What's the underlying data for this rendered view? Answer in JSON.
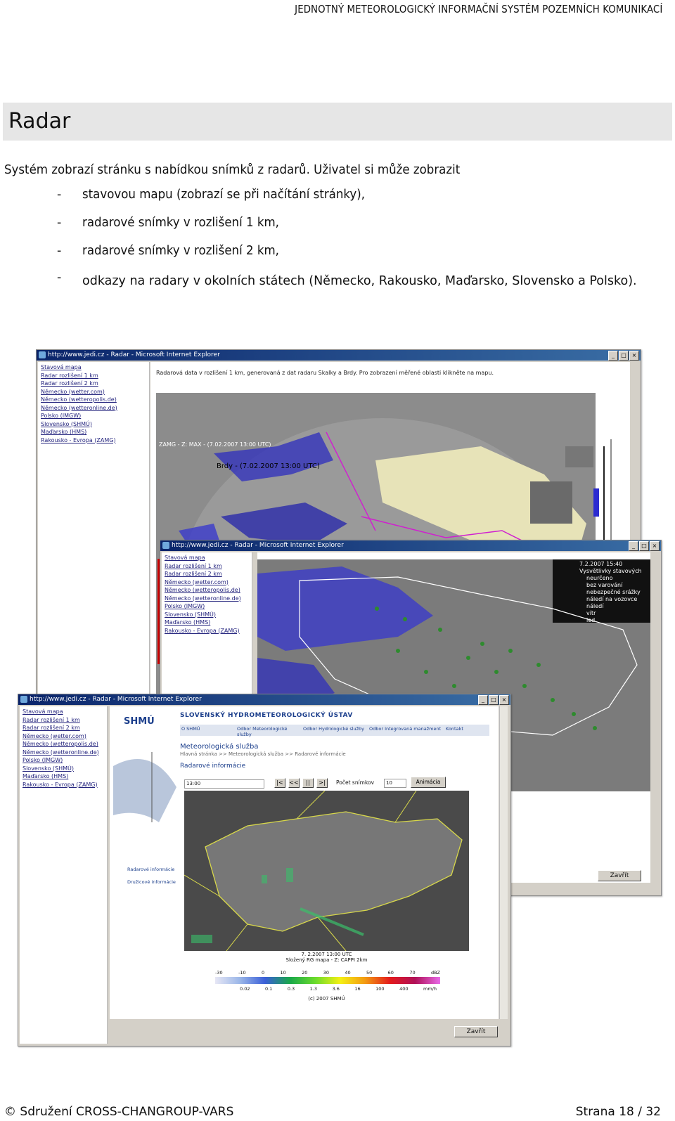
{
  "header": {
    "title": "JEDNOTNÝ METEOROLOGICKÝ INFORMAČNÍ SYSTÉM POZEMNÍCH KOMUNIKACÍ"
  },
  "section": {
    "title": "Radar"
  },
  "intro": "Systém zobrazí stránku s nabídkou snímků z radarů. Uživatel si může zobrazit",
  "bullets": [
    "stavovou mapu (zobrazí se při načítání stránky),",
    "radarové snímky v rozlišení 1 km,",
    "radarové snímky v rozlišení 2 km,",
    "odkazy na radary v okolních státech (Německo, Rakousko, Maďarsko, Slovensko a Polsko)."
  ],
  "bullet_dash": "-",
  "footer": {
    "left": "© Sdružení CROSS-CHANGROUP-VARS",
    "right": "Strana 18 / 32"
  },
  "screens": {
    "back": {
      "title": "http://www.jedi.cz - Radar - Microsoft Internet Explorer",
      "links": [
        "Stavová mapa",
        "Radar rozlišení 1 km",
        "Radar rozlišení 2 km",
        "Německo (wetter.com)",
        "Německo (wetteropolis.de)",
        "Německo (wetteronline.de)",
        "Polsko (IMGW)",
        "Slovensko (SHMÚ)",
        "Maďarsko (HMS)",
        "Rakousko - Evropa (ZAMG)"
      ],
      "note": "Radarová data v rozlišení 1 km, generovaná z dat radaru Skalky a Brdy. Pro zobrazení měřené oblasti klikněte na mapu.",
      "stamp1": "ZAMG - Z: MAX - (7.02.2007 13:00 UTC)",
      "stamp2": "Brdy - (7.02.2007 13:00 UTC)"
    },
    "middle": {
      "title": "http://www.jedi.cz - Radar - Microsoft Internet Explorer",
      "links": [
        "Stavová mapa",
        "Radar rozlišení 1 km",
        "Radar rozlišení 2 km",
        "Německo (wetter.com)",
        "Německo (wetteropolis.de)",
        "Německo (wetteronline.de)",
        "Polsko (IMGW)",
        "Slovensko (SHMÚ)",
        "Maďarsko (HMS)",
        "Rakousko - Evropa (ZAMG)"
      ],
      "legend_time": "7.2.2007 15:40",
      "legend_title": "Vysvětlivky stavových",
      "legend_items": [
        "neurčeno",
        "bez varování",
        "nebezpečné srážky",
        "náledí na vozovce",
        "náledí",
        "vítr",
        "led"
      ],
      "close": "Zavřít"
    },
    "front": {
      "title": "http://www.jedi.cz - Radar - Microsoft Internet Explorer",
      "links": [
        "Stavová mapa",
        "Radar rozlišení 1 km",
        "Radar rozlišení 2 km",
        "Německo (wetter.com)",
        "Německo (wetteropolis.de)",
        "Německo (wetteronline.de)",
        "Polsko (IMGW)",
        "Slovensko (SHMÚ)",
        "Maďarsko (HMS)",
        "Rakousko - Evropa (ZAMG)"
      ],
      "shmu_logo": "SHMÚ",
      "shmu_title": "SLOVENSKÝ HYDROMETEOROLOGICKÝ ÚSTAV",
      "tabs": [
        "O SHMÚ",
        "Odbor Meteorologické služby",
        "Odbor Hydrologické služby",
        "Odbor Integrovaná manažment",
        "Kontakt"
      ],
      "service": "Meteorologická služba",
      "crumb": "Hlavná stránka >> Meteorologická služba >> Radarové informácie",
      "subtitle": "Radarové informácie",
      "time_select": "13:00",
      "nav_btns": [
        "|<",
        "<<",
        "||",
        ">|"
      ],
      "count_label": "Počet snímkov",
      "count_value": "10",
      "anim_btn": "Animácia",
      "side_items": [
        "Radarové informácie",
        "Družicové informácie"
      ],
      "caption1": "7. 2.2007 13:00 UTC",
      "caption2": "Složený RG mapa - Z: CAPPI 2km",
      "scale_top": [
        "-30",
        "-10",
        "0",
        "10",
        "20",
        "30",
        "40",
        "50",
        "60",
        "70",
        "dBZ"
      ],
      "scale_bottom": [
        "0.02",
        "0.1",
        "0.3",
        "1.3",
        "3.6",
        "16",
        "100",
        "400",
        "mm/h"
      ],
      "copyright": "(c) 2007 SHMÚ",
      "close": "Zavřít"
    }
  }
}
